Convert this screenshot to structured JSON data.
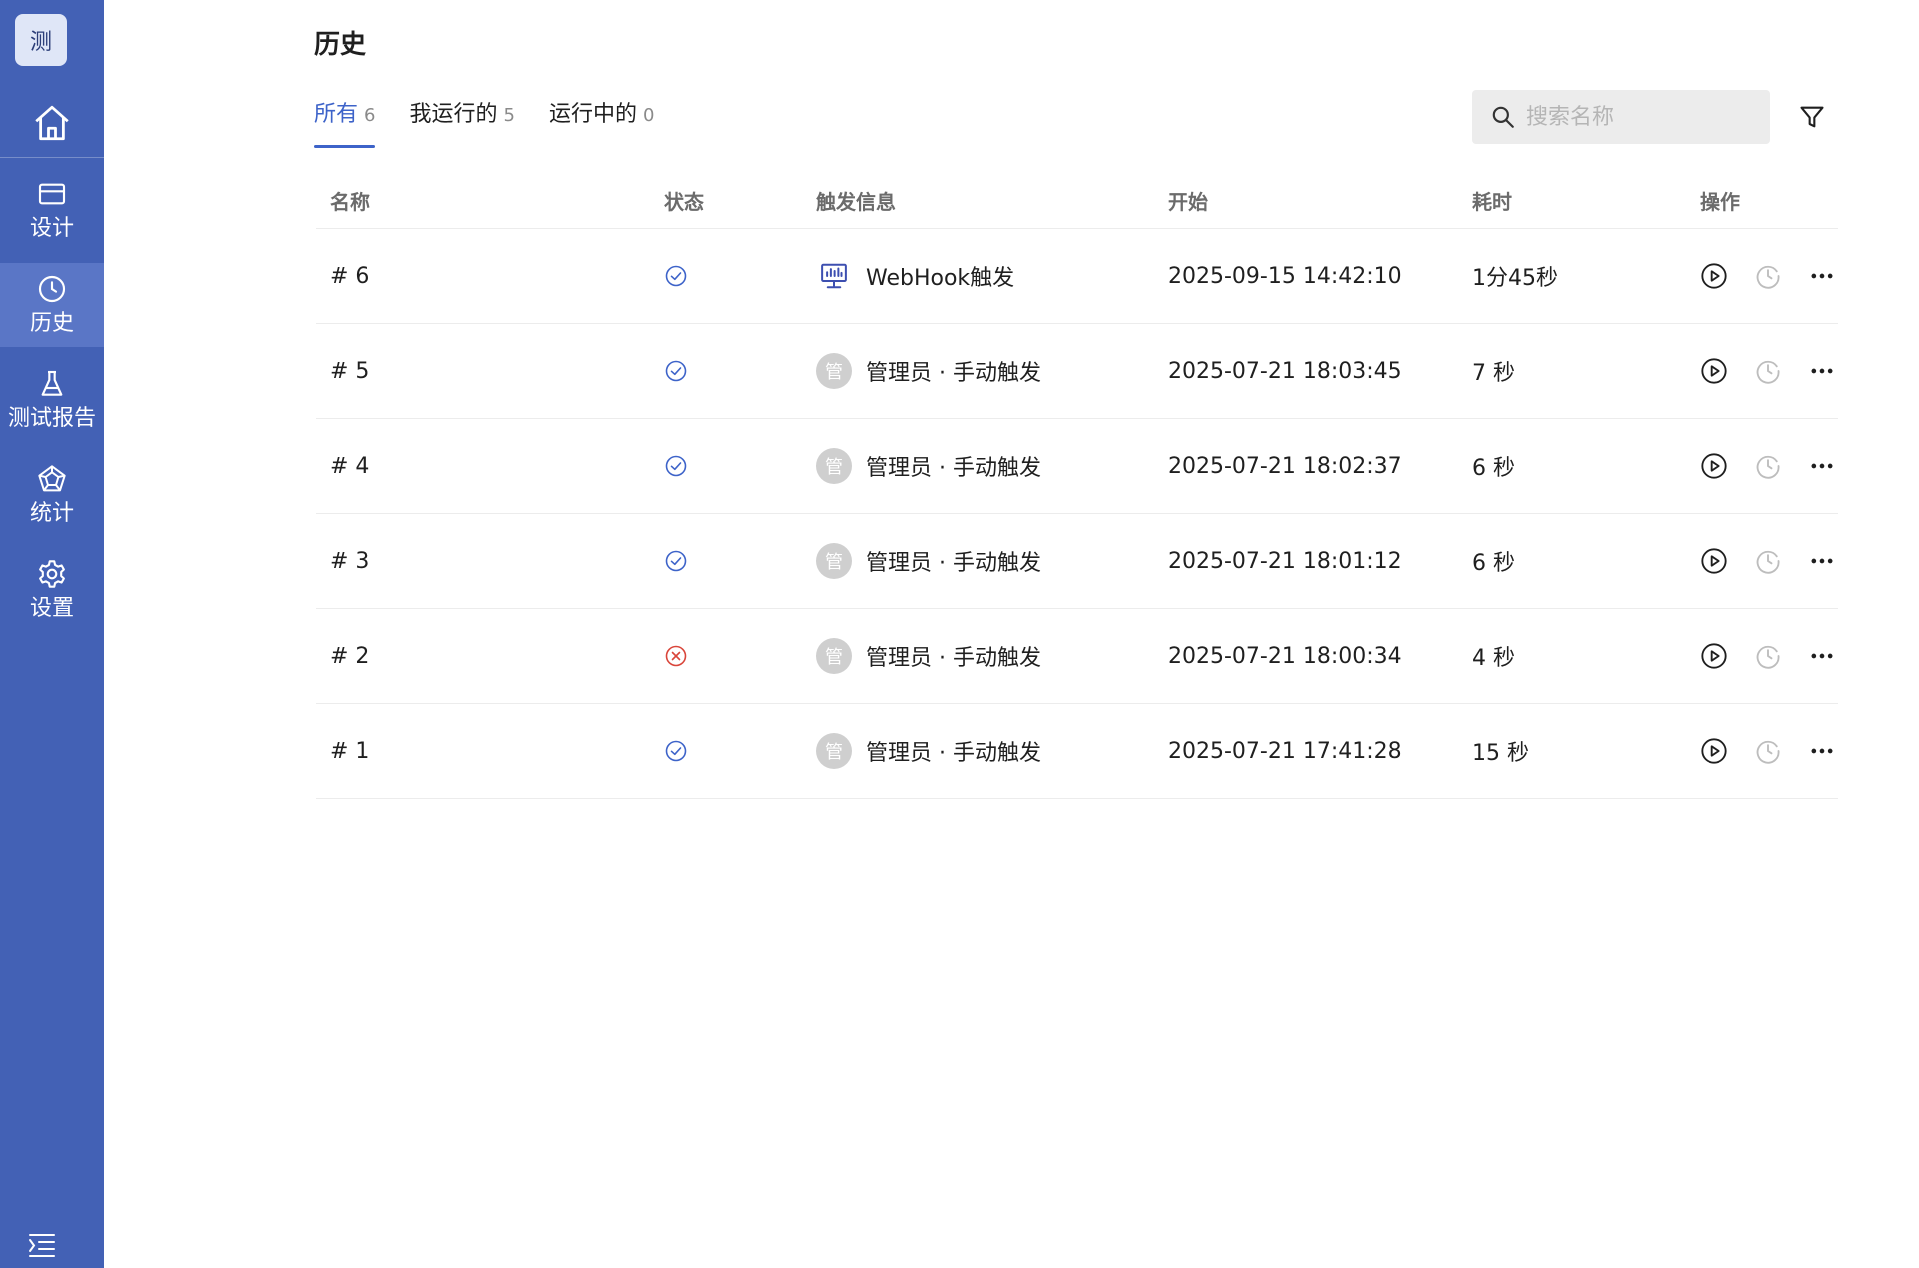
{
  "sidebar": {
    "logo_text": "测",
    "items": [
      {
        "label": "设计",
        "icon": "card-icon"
      },
      {
        "label": "历史",
        "icon": "clock-icon",
        "active": true
      },
      {
        "label": "测试报告",
        "icon": "flask-icon"
      },
      {
        "label": "统计",
        "icon": "pentagon-chart-icon"
      },
      {
        "label": "设置",
        "icon": "gear-icon"
      }
    ],
    "accent_color": "#4361b5"
  },
  "page": {
    "title": "历史"
  },
  "tabs": [
    {
      "label": "所有",
      "count": "6",
      "active": true
    },
    {
      "label": "我运行的",
      "count": "5"
    },
    {
      "label": "运行中的",
      "count": "0"
    }
  ],
  "search": {
    "placeholder": "搜索名称",
    "value": ""
  },
  "table": {
    "columns": [
      "名称",
      "状态",
      "触发信息",
      "开始",
      "耗时",
      "操作"
    ],
    "rows": [
      {
        "name": "# 6",
        "status": "success",
        "trigger_type": "webhook",
        "avatar": "",
        "trigger": "WebHook触发",
        "start": "2025-09-15 14:42:10",
        "duration": "1分45秒"
      },
      {
        "name": "# 5",
        "status": "success",
        "trigger_type": "manual",
        "avatar": "管",
        "trigger": "管理员 · 手动触发",
        "start": "2025-07-21 18:03:45",
        "duration": "7 秒"
      },
      {
        "name": "# 4",
        "status": "success",
        "trigger_type": "manual",
        "avatar": "管",
        "trigger": "管理员 · 手动触发",
        "start": "2025-07-21 18:02:37",
        "duration": "6 秒"
      },
      {
        "name": "# 3",
        "status": "success",
        "trigger_type": "manual",
        "avatar": "管",
        "trigger": "管理员 · 手动触发",
        "start": "2025-07-21 18:01:12",
        "duration": "6 秒"
      },
      {
        "name": "# 2",
        "status": "failed",
        "trigger_type": "manual",
        "avatar": "管",
        "trigger": "管理员 · 手动触发",
        "start": "2025-07-21 18:00:34",
        "duration": "4 秒"
      },
      {
        "name": "# 1",
        "status": "success",
        "trigger_type": "manual",
        "avatar": "管",
        "trigger": "管理员 · 手动触发",
        "start": "2025-07-21 17:41:28",
        "duration": "15 秒"
      }
    ]
  },
  "colors": {
    "success": "#3d63c9",
    "failed": "#d9453a",
    "tab_active": "#3d63c9"
  }
}
